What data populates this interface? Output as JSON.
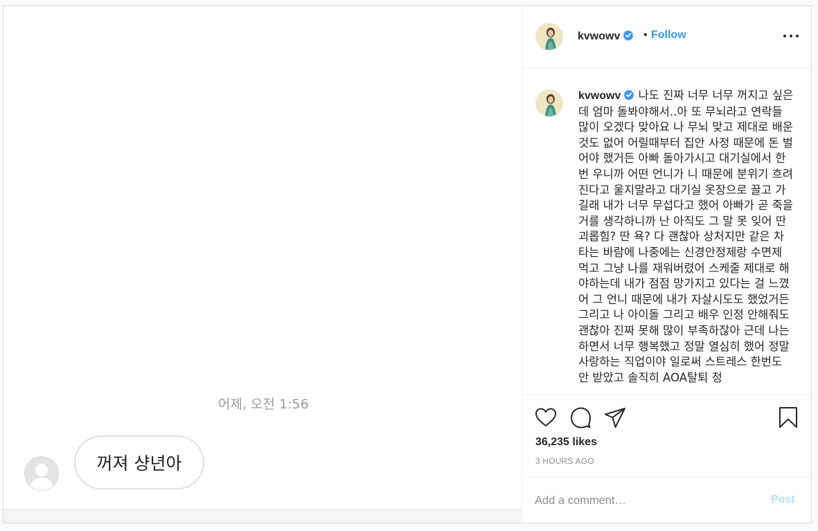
{
  "media": {
    "chat_time": "어제, 오전 1:56",
    "chat_message": "꺼져 샹년아"
  },
  "header": {
    "username": "kvwowv",
    "separator": "•",
    "follow_label": "Follow"
  },
  "caption": {
    "username": "kvwowv",
    "text": "나도 진짜 너무 너무 꺼지고 싶은데 엄마 돌봐야해서..아 또 무뇌라고 연락들 많이 오겠다 맞아요 나 무뇌 맞고 제대로 배운것도 없어 어릴때부터 집안 사정 때문에 돈 벌어야 했거든 아빠 돌아가시고 대기실에서 한번 우니까 어떤 언니가 니 때문에 분위기 흐려진다고 울지말라고 대기실 옷장으로 끌고 가길래 내가 너무 무섭다고 했어 아빠가 곧 죽을거를 생각하니까 난 아직도 그 말 못 잊어 딴 괴롭힘? 딴 욕? 다 괜찮아 상처지만 같은 차 타는 바람에 나중에는 신경안정제랑 수면제 먹고 그냥 나를 재워버렸어 스케줄 제대로 해야하는데 내가 점점 망가지고 있다는 걸 느꼈어 그 언니 때문에 내가 자살시도도 했었거든 그리고 나 아이돌 그리고 배우 인정 안해줘도 괜찮아 진짜 못해 많이 부족하잖아 근데 나는 하면서 너무 행복했고 정말 열심히 했어 정말 사랑하는 직업이야 일로써 스트레스 한번도 안 받았고 솔직히 AOA탈퇴 정"
  },
  "actions": {
    "likes": "36,235 likes",
    "time_ago": "3 HOURS AGO"
  },
  "comment": {
    "placeholder": "Add a comment…",
    "post_label": "Post"
  },
  "colors": {
    "accent": "#3897f0",
    "post_disabled": "#b2dffc",
    "verified": "#3897f0",
    "text": "#262626",
    "muted": "#8e8e8e"
  },
  "icons": [
    "more-icon",
    "verified-badge-icon",
    "heart-icon",
    "comment-icon",
    "share-icon",
    "bookmark-icon",
    "default-avatar-icon"
  ]
}
